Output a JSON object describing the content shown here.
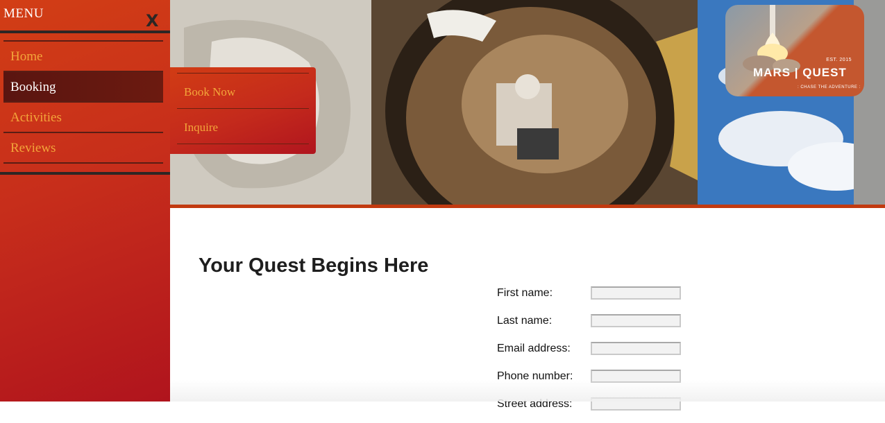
{
  "sidebar": {
    "title": "MENU",
    "close_label": "X",
    "items": [
      {
        "label": "Home"
      },
      {
        "label": "Booking"
      },
      {
        "label": "Activities"
      },
      {
        "label": "Reviews"
      }
    ]
  },
  "submenu": {
    "items": [
      {
        "label": "Book Now"
      },
      {
        "label": "Inquire"
      }
    ]
  },
  "logo": {
    "est": "EST. 2015",
    "name": "MARS | QUEST",
    "tagline": ": CHASE THE ADVENTURE :"
  },
  "main": {
    "title": "Your Quest Begins Here",
    "form": {
      "fields": [
        {
          "label": "First name:",
          "value": ""
        },
        {
          "label": "Last name:",
          "value": ""
        },
        {
          "label": "Email address:",
          "value": ""
        },
        {
          "label": "Phone number:",
          "value": ""
        },
        {
          "label": "Street address:",
          "value": ""
        }
      ]
    }
  },
  "colors": {
    "accent": "#f3a53a",
    "sidebar_red": "#c72e1b",
    "active_item": "#5a1510",
    "divider": "#2d2624"
  }
}
